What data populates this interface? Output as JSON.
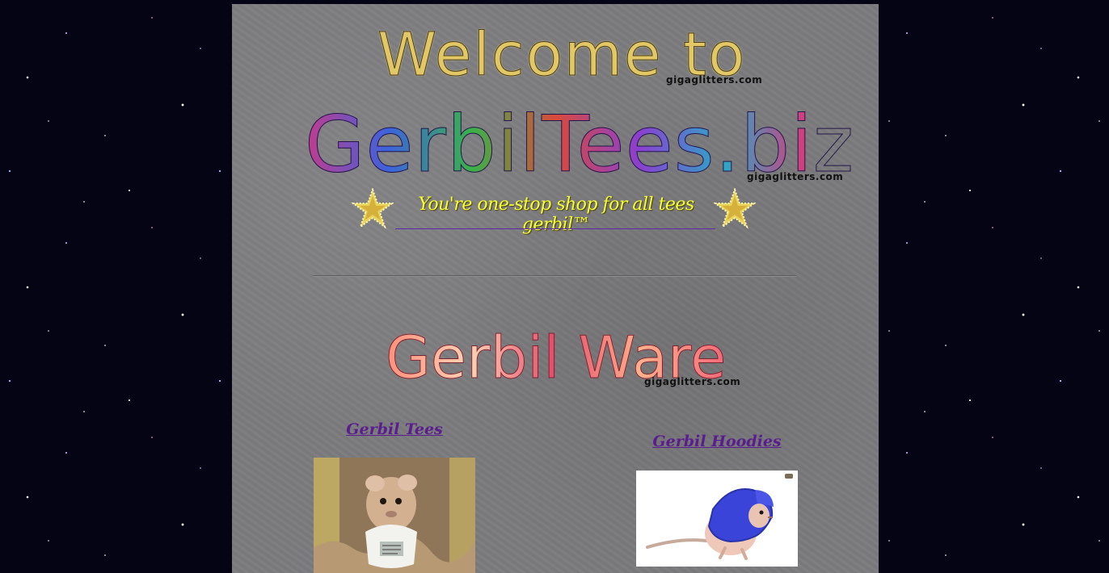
{
  "header": {
    "welcome_text": "Welcome to",
    "welcome_watermark": "gigaglitters.com",
    "site_name": "GerbilTees.biz",
    "site_name_watermark": "gigaglitters.com",
    "tagline": "You're one-stop shop for all tees gerbil™"
  },
  "section": {
    "heading": "Gerbil Ware",
    "heading_watermark": "gigaglitters.com"
  },
  "products": [
    {
      "label": "Gerbil Tees",
      "image": "gerbil-in-tee-photo"
    },
    {
      "label": "Gerbil Hoodies",
      "image": "gerbil-in-hoodie-photo"
    }
  ],
  "colors": {
    "page_background": "#7c7c7e",
    "space_background": "#050414",
    "tagline": "#f6ff33",
    "link": "#5a1d8e",
    "underline": "#5a2aa8"
  },
  "icons": [
    "glitter-star-icon"
  ]
}
